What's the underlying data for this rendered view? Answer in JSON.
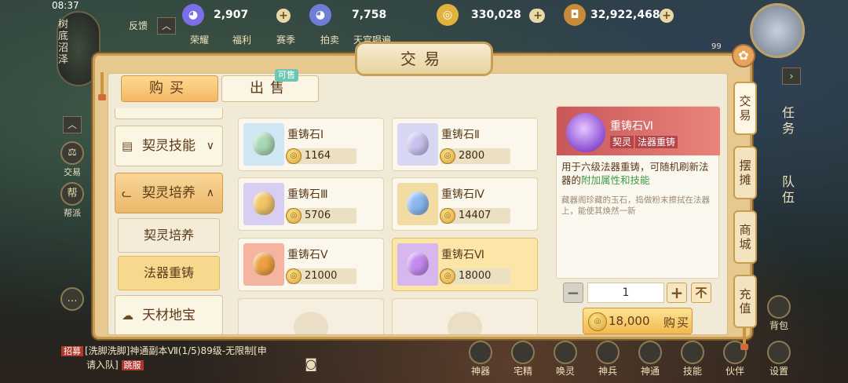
{
  "status": {
    "time": "08:37"
  },
  "map": {
    "location": "树底沼泽"
  },
  "top_bar": {
    "resources": [
      {
        "icon": "spirit-orb-icon",
        "value": "2,907",
        "color": "#7b6ee6"
      },
      {
        "icon": "bound-spirit-orb-icon",
        "value": "7,758",
        "color": "#6f7fd8"
      },
      {
        "icon": "gold-coin-icon",
        "value": "330,028",
        "color": "#e2b23e"
      },
      {
        "icon": "copper-coin-icon",
        "value": "32,922,468",
        "color": "#c98a3a"
      }
    ],
    "menu": [
      "反馈",
      "荣耀",
      "福利",
      "赛季",
      "拍卖",
      "天宫唱遍"
    ],
    "menu_badge": "99"
  },
  "left_sidebar": {
    "trade": "交易",
    "guild": "帮派",
    "guild_icon_text": "帮"
  },
  "chat": {
    "lines": [
      {
        "tag": "招募",
        "text": "[洗脚洗脚]神通副本Ⅶ(1/5)89级-无限制[申",
        "tail": ""
      },
      {
        "tag": "",
        "text": "请入队]",
        "tail": "跳服"
      }
    ]
  },
  "right_panel": {
    "task": "任务",
    "team": "队伍",
    "bag": "背包",
    "settings": "设置"
  },
  "bottom_bar": [
    "神器",
    "宅精",
    "唤灵",
    "神兵",
    "神通",
    "技能",
    "伙伴",
    "设置"
  ],
  "trade": {
    "title": "交易",
    "close_icon": "close-icon",
    "tabs": {
      "buy": "购买",
      "sell": "出售",
      "sell_badge": "可售"
    },
    "categories": [
      {
        "label": "契灵技能",
        "icon": "scroll-icon",
        "expanded": false
      },
      {
        "label": "契灵培养",
        "icon": "cat-icon",
        "expanded": true
      },
      {
        "label": "天材地宝",
        "icon": "treasure-icon",
        "expanded": false
      }
    ],
    "subcategories": [
      "契灵培养",
      "法器重铸"
    ],
    "active_subcategory": "法器重铸",
    "items": [
      {
        "name": "重铸石Ⅰ",
        "price": "1164",
        "color": "#a8d8b4",
        "bg": "#cfe6f4"
      },
      {
        "name": "重铸石Ⅱ",
        "price": "2800",
        "color": "#c9c2f0",
        "bg": "#d7d7f4"
      },
      {
        "name": "重铸石Ⅲ",
        "price": "5706",
        "color": "#f2c464",
        "bg": "#d8cdf2"
      },
      {
        "name": "重铸石Ⅳ",
        "price": "14407",
        "color": "#8ab8f0",
        "bg": "#f2dca4"
      },
      {
        "name": "重铸石Ⅴ",
        "price": "21000",
        "color": "#f0a040",
        "bg": "#f4b4a0"
      },
      {
        "name": "重铸石Ⅵ",
        "price": "18000",
        "color": "#c58af2",
        "bg": "#d8b6ee"
      }
    ],
    "selected_item_index": 5,
    "detail": {
      "name": "重铸石Ⅵ",
      "tags": [
        "契灵",
        "法器重铸"
      ],
      "desc_a": "用于六级法器重铸，可随机刷新法器的",
      "desc_highlight": "附加属性和技能",
      "lore": "藏器阁珍藏的玉石，捣做粉末擦拭在法器上，能使其焕然一新"
    },
    "quantity": "1",
    "qty_max_label": "不",
    "buy": {
      "price": "18,000",
      "label": "购买"
    },
    "side_nav": [
      "交易",
      "摆摊",
      "商城",
      "充值"
    ]
  }
}
